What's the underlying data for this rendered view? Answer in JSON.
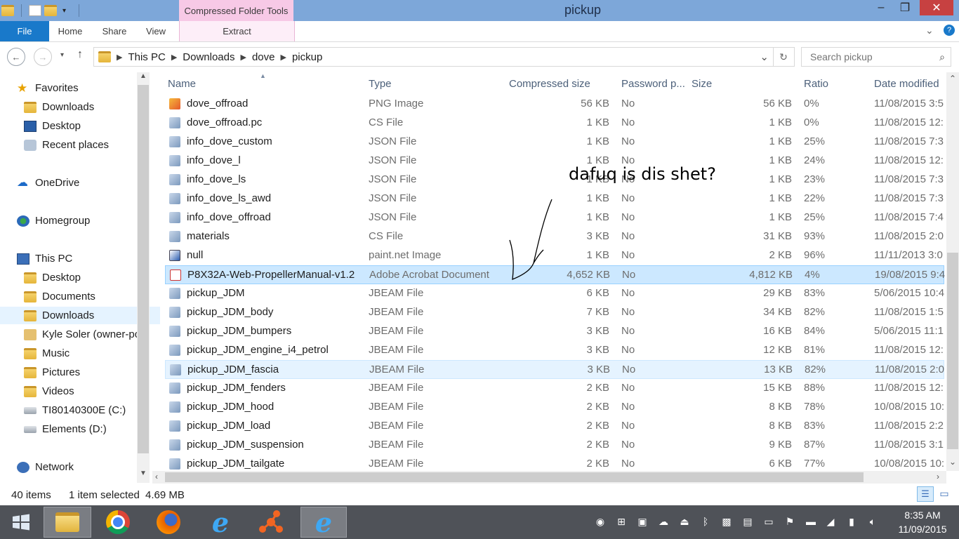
{
  "window": {
    "title": "pickup",
    "context_tab": "Compressed Folder Tools"
  },
  "ribbon": {
    "tabs": [
      "File",
      "Home",
      "Share",
      "View"
    ],
    "extract": "Extract"
  },
  "address": {
    "crumbs": [
      "This PC",
      "Downloads",
      "dove",
      "pickup"
    ]
  },
  "search": {
    "placeholder": "Search pickup"
  },
  "nav": {
    "favorites": "Favorites",
    "fav_items": [
      "Downloads",
      "Desktop",
      "Recent places"
    ],
    "onedrive": "OneDrive",
    "homegroup": "Homegroup",
    "thispc": "This PC",
    "pc_items": [
      "Desktop",
      "Documents",
      "Downloads",
      "Kyle Soler (owner-pc)",
      "Music",
      "Pictures",
      "Videos",
      "TI80140300E (C:)",
      "Elements (D:)"
    ],
    "network": "Network"
  },
  "columns": {
    "name": "Name",
    "type": "Type",
    "compressed": "Compressed size",
    "password": "Password p...",
    "size": "Size",
    "ratio": "Ratio",
    "date": "Date modified"
  },
  "files": [
    {
      "name": "dove_offroad",
      "type": "PNG Image",
      "csize": "56 KB",
      "pw": "No",
      "size": "56 KB",
      "ratio": "0%",
      "date": "11/08/2015 3:5"
    },
    {
      "name": "dove_offroad.pc",
      "type": "CS File",
      "csize": "1 KB",
      "pw": "No",
      "size": "1 KB",
      "ratio": "0%",
      "date": "11/08/2015 12:"
    },
    {
      "name": "info_dove_custom",
      "type": "JSON File",
      "csize": "1 KB",
      "pw": "No",
      "size": "1 KB",
      "ratio": "25%",
      "date": "11/08/2015 7:3"
    },
    {
      "name": "info_dove_l",
      "type": "JSON File",
      "csize": "1 KB",
      "pw": "No",
      "size": "1 KB",
      "ratio": "24%",
      "date": "11/08/2015 12:"
    },
    {
      "name": "info_dove_ls",
      "type": "JSON File",
      "csize": "1 KB",
      "pw": "No",
      "size": "1 KB",
      "ratio": "23%",
      "date": "11/08/2015 7:3"
    },
    {
      "name": "info_dove_ls_awd",
      "type": "JSON File",
      "csize": "1 KB",
      "pw": "No",
      "size": "1 KB",
      "ratio": "22%",
      "date": "11/08/2015 7:3"
    },
    {
      "name": "info_dove_offroad",
      "type": "JSON File",
      "csize": "1 KB",
      "pw": "No",
      "size": "1 KB",
      "ratio": "25%",
      "date": "11/08/2015 7:4"
    },
    {
      "name": "materials",
      "type": "CS File",
      "csize": "3 KB",
      "pw": "No",
      "size": "31 KB",
      "ratio": "93%",
      "date": "11/08/2015 2:0"
    },
    {
      "name": "null",
      "type": "paint.net Image",
      "csize": "1 KB",
      "pw": "No",
      "size": "2 KB",
      "ratio": "96%",
      "date": "11/11/2013 3:0"
    },
    {
      "name": "P8X32A-Web-PropellerManual-v1.2",
      "type": "Adobe Acrobat Document",
      "csize": "4,652 KB",
      "pw": "No",
      "size": "4,812 KB",
      "ratio": "4%",
      "date": "19/08/2015 9:4"
    },
    {
      "name": "pickup_JDM",
      "type": "JBEAM File",
      "csize": "6 KB",
      "pw": "No",
      "size": "29 KB",
      "ratio": "83%",
      "date": "5/06/2015 10:4"
    },
    {
      "name": "pickup_JDM_body",
      "type": "JBEAM File",
      "csize": "7 KB",
      "pw": "No",
      "size": "34 KB",
      "ratio": "82%",
      "date": "11/08/2015 1:5"
    },
    {
      "name": "pickup_JDM_bumpers",
      "type": "JBEAM File",
      "csize": "3 KB",
      "pw": "No",
      "size": "16 KB",
      "ratio": "84%",
      "date": "5/06/2015 11:1"
    },
    {
      "name": "pickup_JDM_engine_i4_petrol",
      "type": "JBEAM File",
      "csize": "3 KB",
      "pw": "No",
      "size": "12 KB",
      "ratio": "81%",
      "date": "11/08/2015 12:"
    },
    {
      "name": "pickup_JDM_fascia",
      "type": "JBEAM File",
      "csize": "3 KB",
      "pw": "No",
      "size": "13 KB",
      "ratio": "82%",
      "date": "11/08/2015 2:0"
    },
    {
      "name": "pickup_JDM_fenders",
      "type": "JBEAM File",
      "csize": "2 KB",
      "pw": "No",
      "size": "15 KB",
      "ratio": "88%",
      "date": "11/08/2015 12:"
    },
    {
      "name": "pickup_JDM_hood",
      "type": "JBEAM File",
      "csize": "2 KB",
      "pw": "No",
      "size": "8 KB",
      "ratio": "78%",
      "date": "10/08/2015 10:"
    },
    {
      "name": "pickup_JDM_load",
      "type": "JBEAM File",
      "csize": "2 KB",
      "pw": "No",
      "size": "8 KB",
      "ratio": "83%",
      "date": "11/08/2015 2:2"
    },
    {
      "name": "pickup_JDM_suspension",
      "type": "JBEAM File",
      "csize": "2 KB",
      "pw": "No",
      "size": "9 KB",
      "ratio": "87%",
      "date": "11/08/2015 3:1"
    },
    {
      "name": "pickup_JDM_tailgate",
      "type": "JBEAM File",
      "csize": "2 KB",
      "pw": "No",
      "size": "6 KB",
      "ratio": "77%",
      "date": "10/08/2015 10:"
    }
  ],
  "status": {
    "count": "40 items",
    "selected": "1 item selected",
    "size": "4.69 MB"
  },
  "annotation": "dafuq is dis shet?",
  "clock": {
    "time": "8:35 AM",
    "date": "11/09/2015"
  }
}
